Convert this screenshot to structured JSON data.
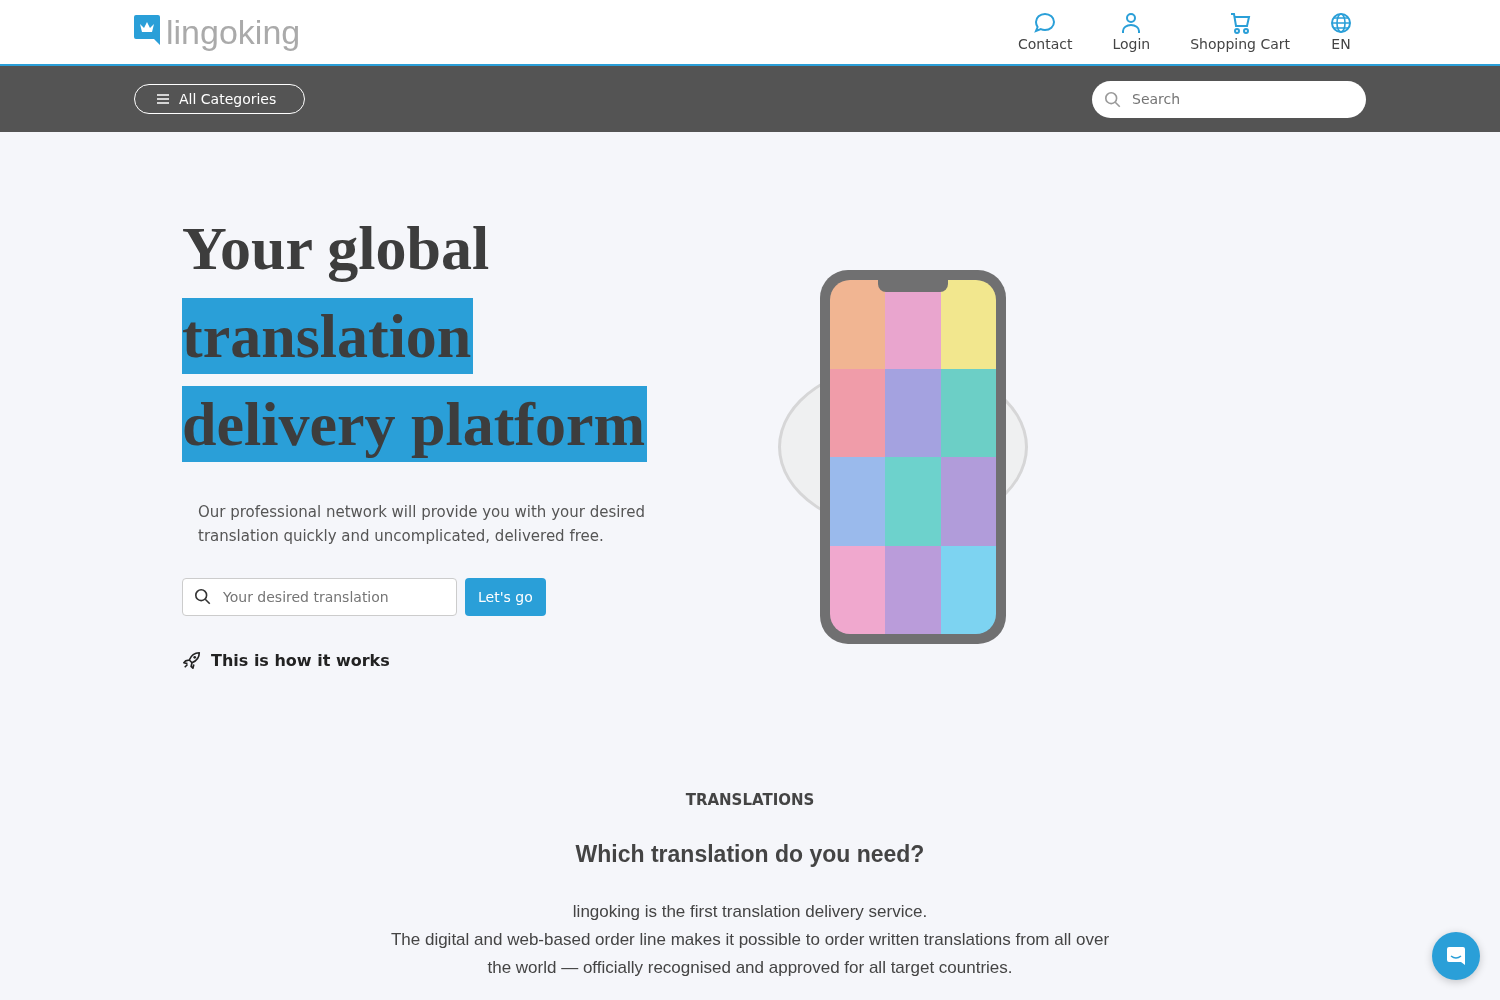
{
  "header": {
    "logo": "lingoking",
    "nav": [
      {
        "kind": "chat",
        "label": "Contact"
      },
      {
        "kind": "user",
        "label": "Login"
      },
      {
        "kind": "cart",
        "label": "Shopping Cart"
      },
      {
        "kind": "globe",
        "label": "EN"
      }
    ]
  },
  "toolbar": {
    "categories_button": "All Categories",
    "search": {
      "placeholder": "Search"
    }
  },
  "hero": {
    "headline": [
      {
        "text": "Your global",
        "highlighted": false
      },
      {
        "text": "translation",
        "highlighted": true
      },
      {
        "text": "delivery platform",
        "highlighted": true
      }
    ],
    "description": "Our professional network will provide you with your desired translation quickly and uncomplicated, delivered free.",
    "search": {
      "placeholder": "Your desired translation"
    },
    "button": "Let's go",
    "how_link": "This is how it works"
  },
  "section": {
    "eyebrow": "TRANSLATIONS",
    "title": "Which translation do you need?",
    "paragraphs": [
      "lingoking is the first translation delivery service.",
      "The digital and web-based order line makes it possible to order written translations from all over the world — officially recognised and approved for all target countries."
    ]
  }
}
